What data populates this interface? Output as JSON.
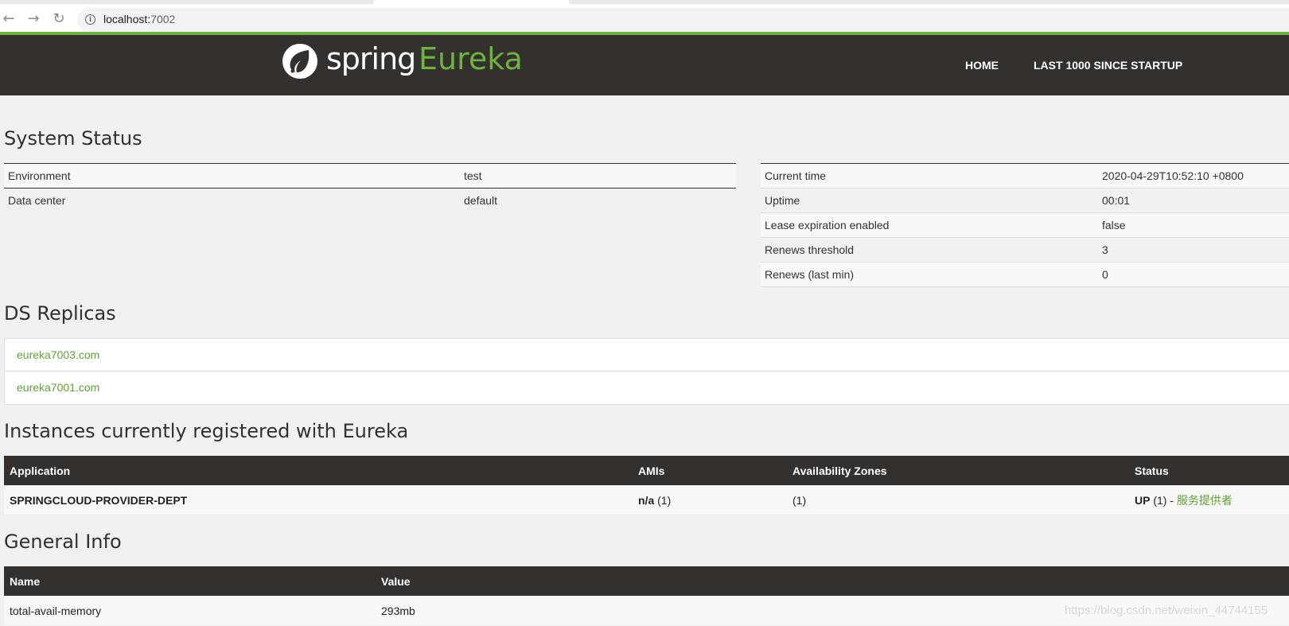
{
  "browser": {
    "back_icon": "arrow-left-icon",
    "forward_icon": "arrow-right-icon",
    "reload_icon": "reload-icon",
    "url_host": "localhost:",
    "url_port": "7002"
  },
  "header": {
    "logo_text": "spring",
    "logo_product": "Eureka",
    "nav": [
      "HOME",
      "LAST 1000 SINCE STARTUP"
    ],
    "colors": {
      "bar": "#34302d",
      "accent": "#6db33f"
    }
  },
  "system_status": {
    "title": "System Status",
    "left": [
      {
        "label": "Environment",
        "value": "test"
      },
      {
        "label": "Data center",
        "value": "default"
      }
    ],
    "right": [
      {
        "label": "Current time",
        "value": "2020-04-29T10:52:10 +0800"
      },
      {
        "label": "Uptime",
        "value": "00:01"
      },
      {
        "label": "Lease expiration enabled",
        "value": "false"
      },
      {
        "label": "Renews threshold",
        "value": "3"
      },
      {
        "label": "Renews (last min)",
        "value": "0"
      }
    ]
  },
  "replicas": {
    "title": "DS Replicas",
    "items": [
      "eureka7003.com",
      "eureka7001.com"
    ]
  },
  "instances": {
    "title": "Instances currently registered with Eureka",
    "columns": [
      "Application",
      "AMIs",
      "Availability Zones",
      "Status"
    ],
    "rows": [
      {
        "application": "SPRINGCLOUD-PROVIDER-DEPT",
        "amis_bold": "n/a",
        "amis_count": " (1)",
        "zones": "(1)",
        "status_bold": "UP",
        "status_count": " (1) - ",
        "status_link": "服务提供者"
      }
    ]
  },
  "general_info": {
    "title": "General Info",
    "columns": [
      "Name",
      "Value"
    ],
    "rows": [
      {
        "name": "total-avail-memory",
        "value": "293mb"
      }
    ]
  },
  "watermark": "https://blog.csdn.net/weixin_44744155"
}
